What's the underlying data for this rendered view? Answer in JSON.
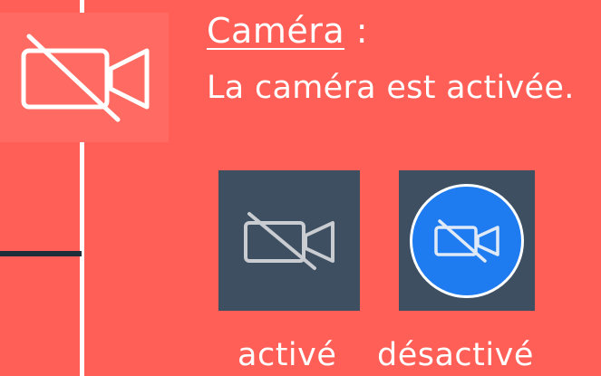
{
  "camera_section": {
    "heading_word": "Caméra",
    "heading_suffix": " :",
    "description": "La caméra est activée."
  },
  "buttons": {
    "active": {
      "caption": "activé",
      "icon": "camera-off-icon"
    },
    "inactive": {
      "caption": "désactivé",
      "icon": "camera-off-icon"
    }
  },
  "icons": {
    "main": "camera-off-icon"
  },
  "colors": {
    "background": "#ff5f57",
    "tile": "#3d4f61",
    "blue": "#1e7bf0",
    "divider_dark": "#1e2e3a"
  }
}
